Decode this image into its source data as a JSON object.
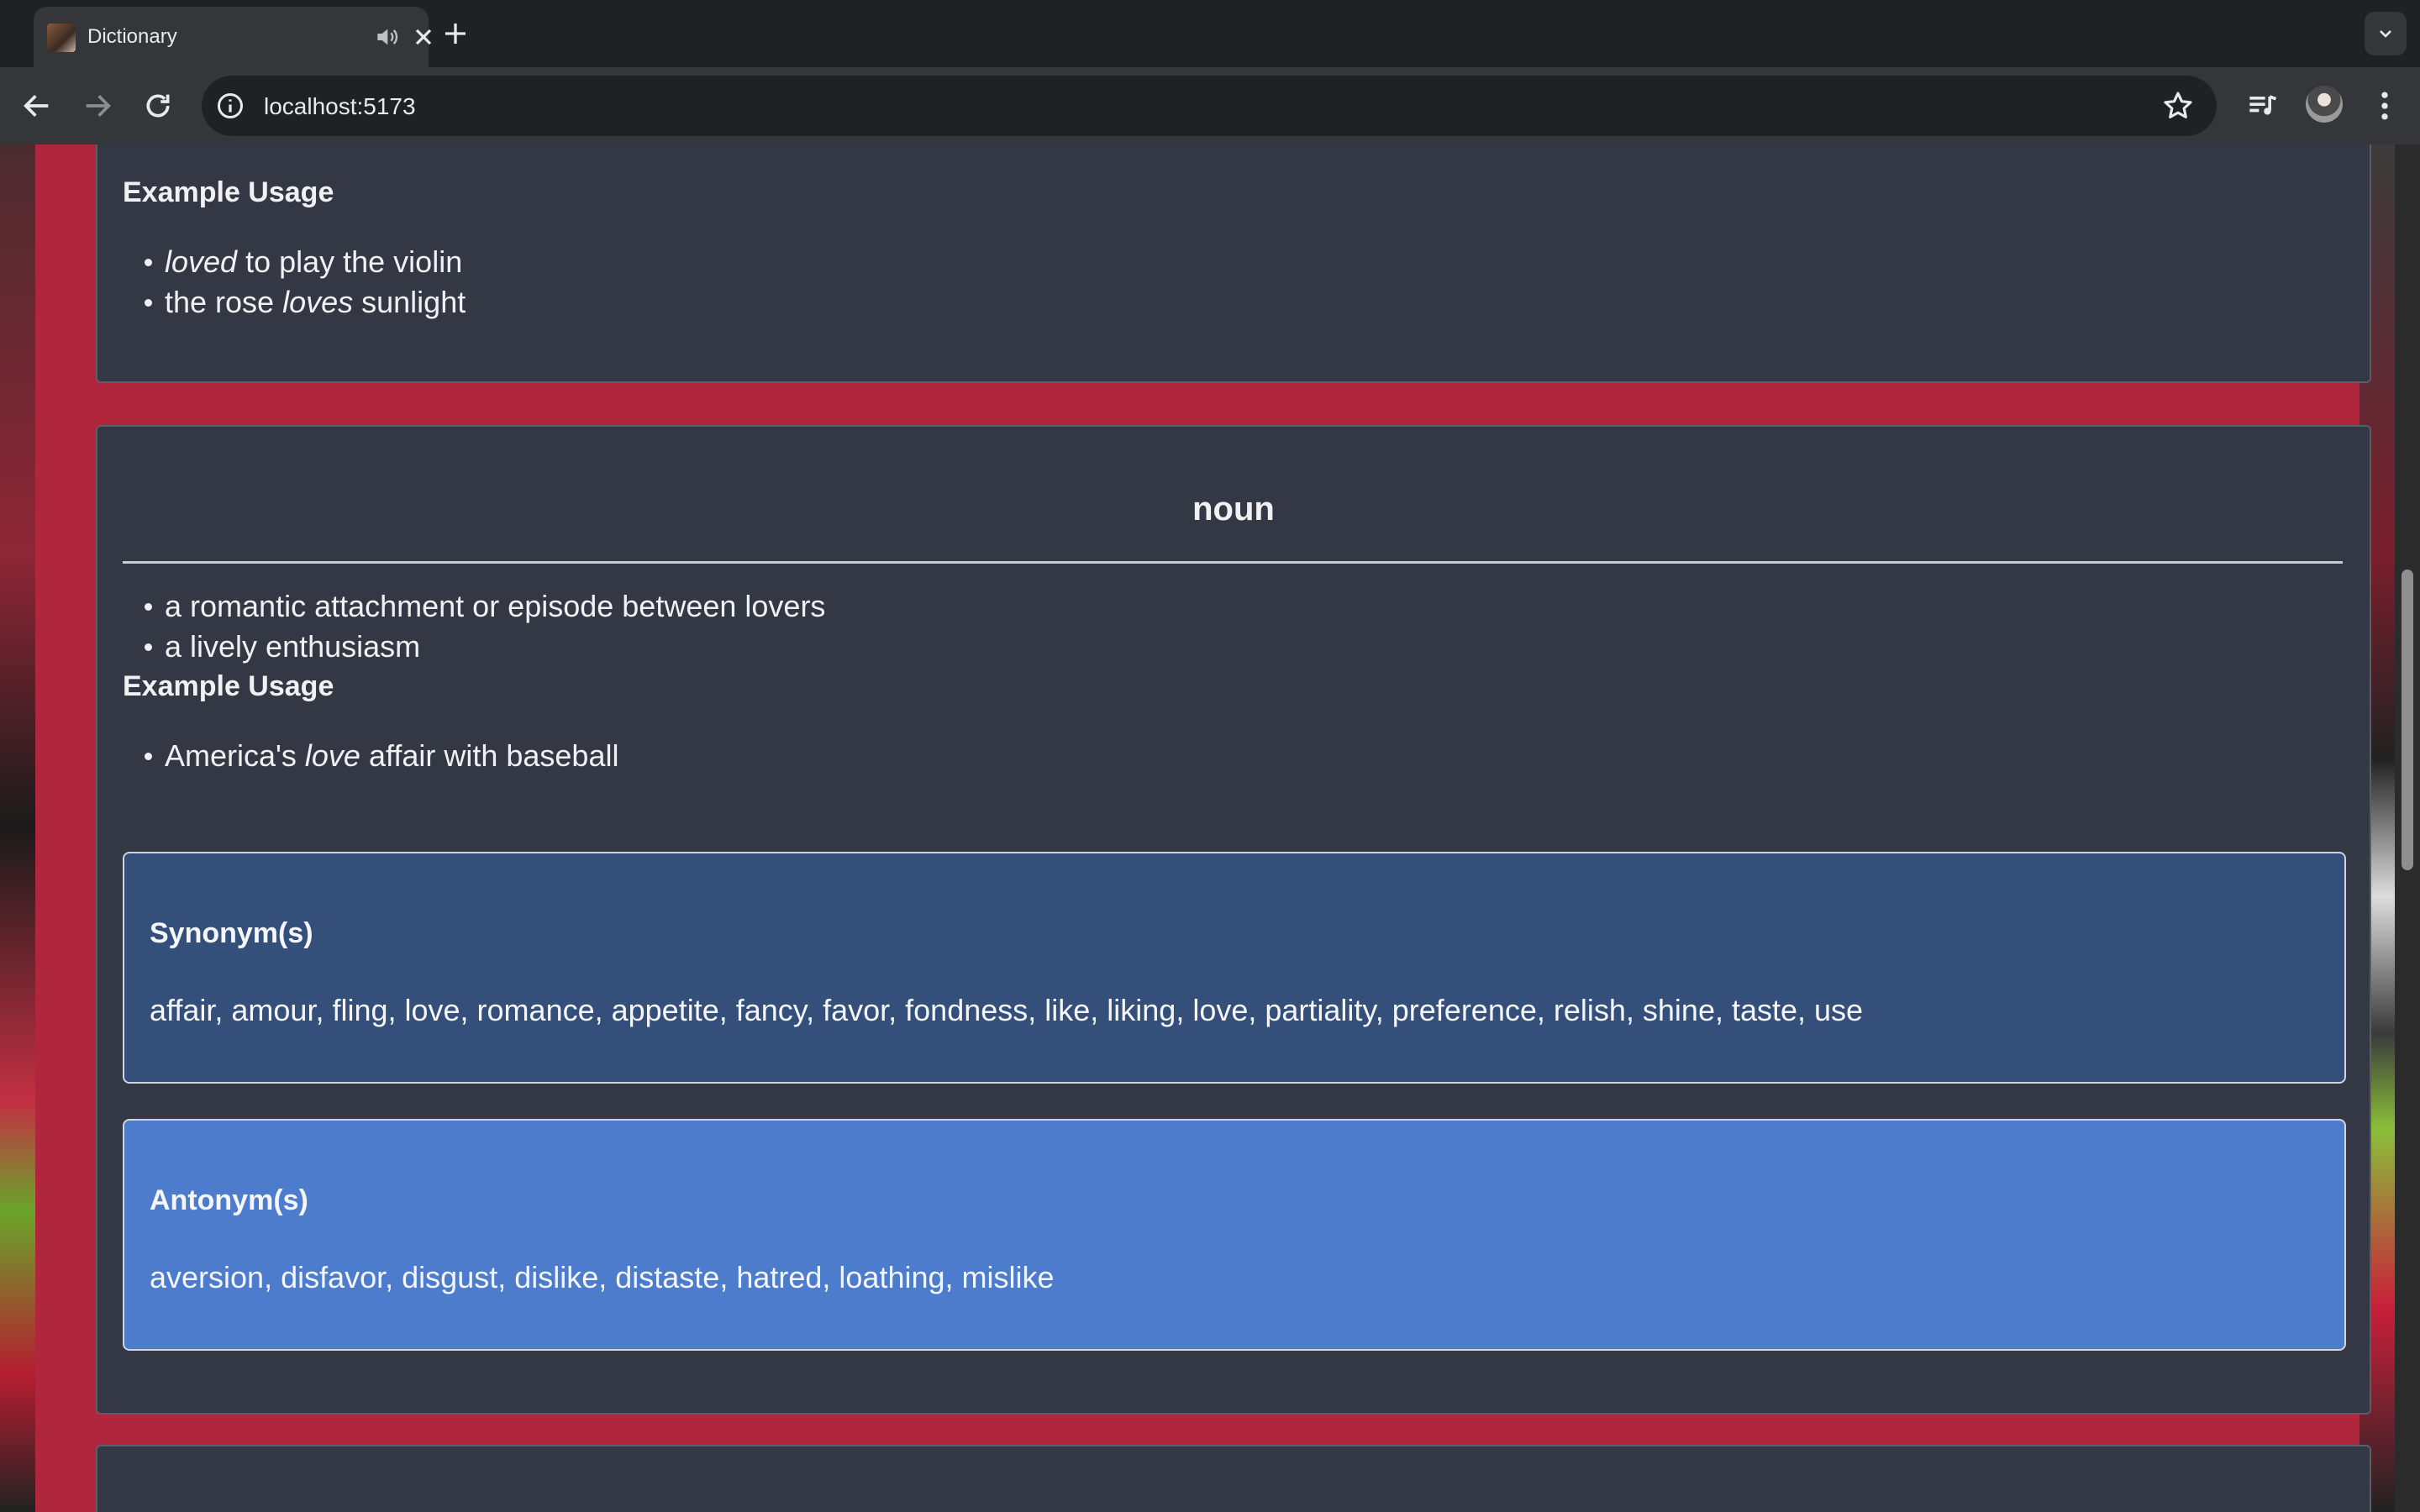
{
  "browser": {
    "tab_title": "Dictionary",
    "url": "localhost:5173"
  },
  "page": {
    "top_section": {
      "example_heading": "Example Usage",
      "examples": [
        {
          "pre": "",
          "em": "loved",
          "post": " to play the violin"
        },
        {
          "pre": "the rose ",
          "em": "loves",
          "post": " sunlight"
        }
      ]
    },
    "noun_section": {
      "part_of_speech": "noun",
      "definitions": [
        "a romantic attachment or episode between lovers",
        "a lively enthusiasm"
      ],
      "example_heading": "Example Usage",
      "examples": [
        {
          "pre": "America's ",
          "em": "love",
          "post": " affair with baseball"
        }
      ],
      "synonyms": {
        "heading": "Synonym(s)",
        "text": "affair, amour, fling, love, romance, appetite, fancy, favor, fondness, like, liking, love, partiality, preference, relish, shine, taste, use"
      },
      "antonyms": {
        "heading": "Antonym(s)",
        "text": "aversion, disfavor, disgust, dislike, distaste, hatred, loathing, mislike"
      }
    }
  },
  "colors": {
    "page_accent": "#b0263d",
    "card_bg": "#333844",
    "synonym_box": "#334f7a",
    "antonym_box": "#4d7ccd"
  }
}
